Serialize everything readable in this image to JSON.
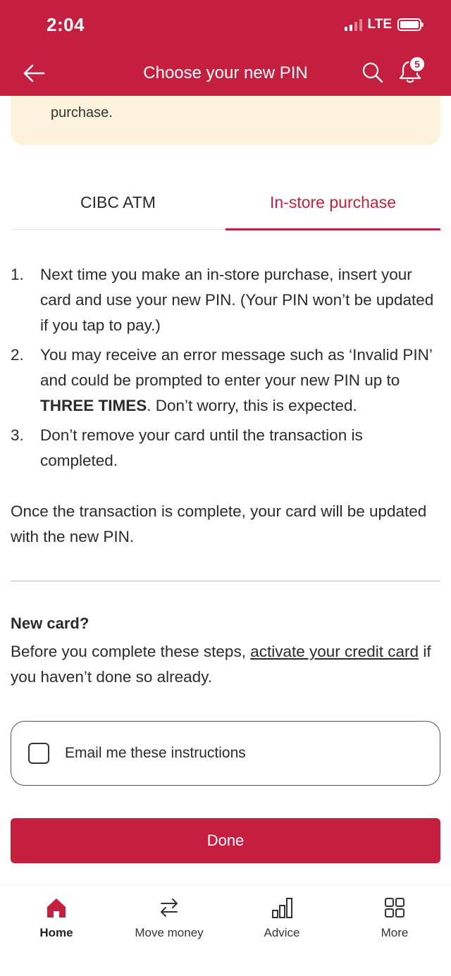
{
  "status_bar": {
    "time": "2:04",
    "network": "LTE"
  },
  "nav": {
    "title": "Choose your new PIN",
    "notification_count": "5"
  },
  "info_box": {
    "visible_text": "purchase."
  },
  "tabs": [
    {
      "label": "CIBC ATM",
      "active": false
    },
    {
      "label": "In-store purchase",
      "active": true
    }
  ],
  "steps": [
    {
      "number": "1.",
      "text": "Next time you make an in-store purchase, insert your card and use your new PIN. (Your PIN won’t be updated if you tap to pay.)"
    },
    {
      "number": "2.",
      "text_before": "You may receive an error message such as ‘Invalid PIN’ and could be prompted to enter your new PIN up to ",
      "text_bold": "THREE TIMES",
      "text_after": ". Don’t worry, this is expected."
    },
    {
      "number": "3.",
      "text": "Don’t remove your card until the transaction is completed."
    }
  ],
  "summary": "Once the transaction is complete, your card will be updated with the new PIN.",
  "new_card": {
    "title": "New card?",
    "text_before": "Before you complete these steps, ",
    "link": "activate your credit card",
    "text_after": " if you haven’t done so already."
  },
  "email_option": {
    "label": "Email me these instructions",
    "checked": false
  },
  "done_button": "Done",
  "bottom_nav": [
    {
      "label": "Home",
      "icon": "home-icon",
      "active": true
    },
    {
      "label": "Move money",
      "icon": "transfer-icon",
      "active": false
    },
    {
      "label": "Advice",
      "icon": "bar-chart-icon",
      "active": false
    },
    {
      "label": "More",
      "icon": "grid-icon",
      "active": false
    }
  ],
  "colors": {
    "brand": "#c41f3e",
    "info_bg": "#fdf3dc"
  }
}
